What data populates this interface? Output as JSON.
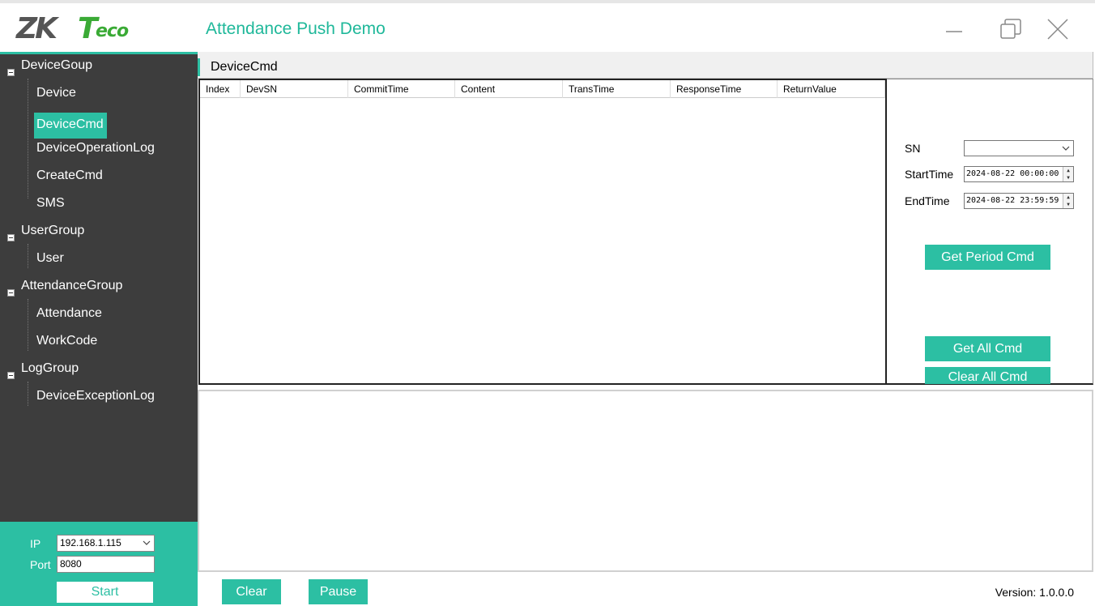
{
  "app": {
    "logo_text": "ZKTeco",
    "title": "Attendance Push Demo"
  },
  "sidebar": {
    "groups": [
      {
        "label": "DeviceGoup",
        "items": [
          "Device",
          "DeviceCmd",
          "DeviceOperationLog",
          "CreateCmd",
          "SMS"
        ]
      },
      {
        "label": "UserGroup",
        "items": [
          "User"
        ]
      },
      {
        "label": "AttendanceGroup",
        "items": [
          "Attendance",
          "WorkCode"
        ]
      },
      {
        "label": "LogGroup",
        "items": [
          "DeviceExceptionLog"
        ]
      }
    ],
    "selected_item": "DeviceCmd"
  },
  "server": {
    "ip_label": "IP",
    "ip_value": "192.168.1.115",
    "port_label": "Port",
    "port_value": "8080",
    "start_label": "Start"
  },
  "panel": {
    "title": "DeviceCmd"
  },
  "grid": {
    "columns": [
      "Index",
      "DevSN",
      "CommitTime",
      "Content",
      "TransTime",
      "ResponseTime",
      "ReturnValue"
    ],
    "rows": []
  },
  "query": {
    "sn_label": "SN",
    "sn_value": "",
    "start_label": "StartTime",
    "start_value": "2024-08-22 00:00:00",
    "end_label": "EndTime",
    "end_value": "2024-08-22 23:59:59",
    "get_period_label": "Get Period Cmd",
    "get_all_label": "Get All Cmd",
    "clear_all_label": "Clear All Cmd"
  },
  "bottom": {
    "clear_label": "Clear",
    "pause_label": "Pause",
    "version": "Version: 1.0.0.0"
  },
  "colors": {
    "accent": "#2cbfa3",
    "sidebar_bg": "#3d3d3d",
    "title_text": "#1fb89a"
  }
}
